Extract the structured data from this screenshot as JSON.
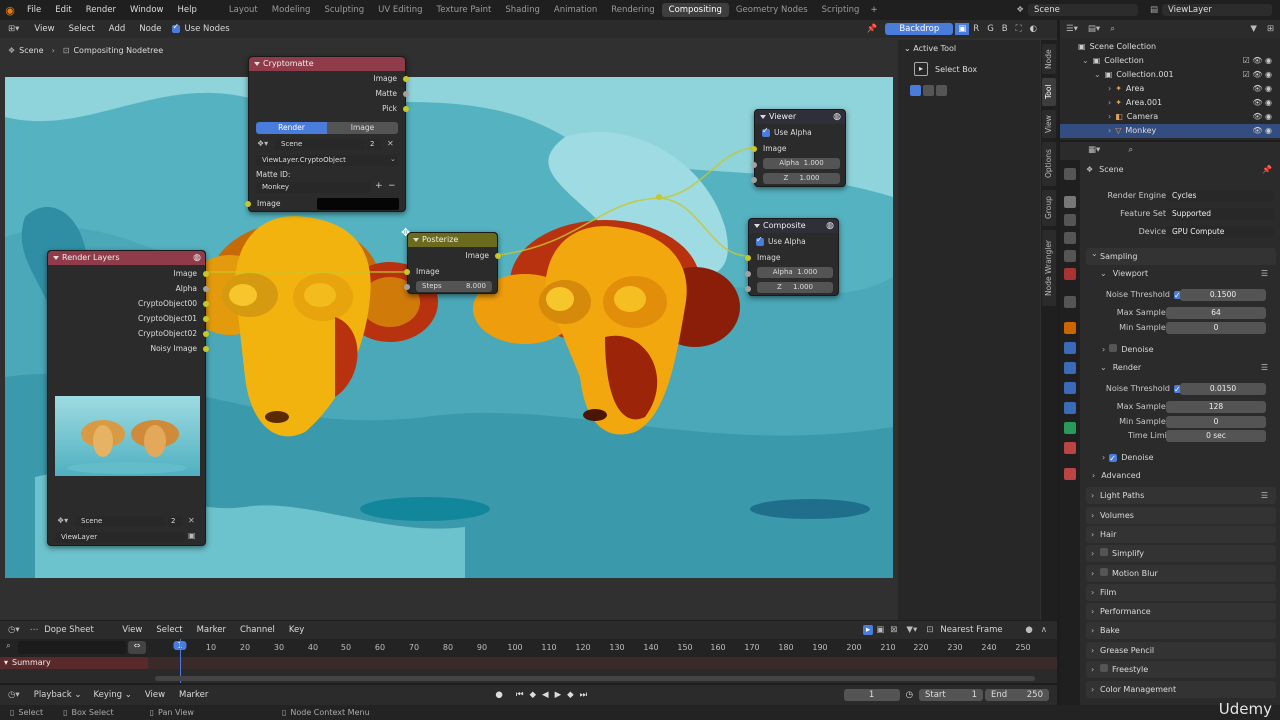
{
  "topbar": {
    "menus": [
      "File",
      "Edit",
      "Render",
      "Window",
      "Help"
    ],
    "workspaces": [
      "Layout",
      "Modeling",
      "Sculpting",
      "UV Editing",
      "Texture Paint",
      "Shading",
      "Animation",
      "Rendering",
      "Compositing",
      "Geometry Nodes",
      "Scripting"
    ],
    "active_workspace": "Compositing",
    "scene_name": "Scene",
    "view_layer": "ViewLayer"
  },
  "node_editor": {
    "menus": [
      "View",
      "Select",
      "Add",
      "Node"
    ],
    "use_nodes_label": "Use Nodes",
    "backdrop_label": "Backdrop",
    "channels": [
      "R",
      "G",
      "B"
    ],
    "breadcrumb": [
      "Scene",
      "Compositing Nodetree"
    ]
  },
  "nodes": {
    "cryptomatte": {
      "title": "Cryptomatte",
      "outputs": [
        "Image",
        "Matte",
        "Pick"
      ],
      "tabs": [
        "Render",
        "Image"
      ],
      "scene": "Scene",
      "scene_users": "2",
      "layer": "ViewLayer.CryptoObject",
      "matte_id_label": "Matte ID:",
      "matte_id": "Monkey",
      "input": "Image"
    },
    "render_layers": {
      "title": "Render Layers",
      "outputs": [
        "Image",
        "Alpha",
        "CryptoObject00",
        "CryptoObject01",
        "CryptoObject02",
        "Noisy Image"
      ],
      "scene": "Scene",
      "scene_users": "2",
      "layer": "ViewLayer"
    },
    "posterize": {
      "title": "Posterize",
      "output": "Image",
      "input": "Image",
      "steps_label": "Steps",
      "steps_value": "8.000"
    },
    "viewer": {
      "title": "Viewer",
      "use_alpha": "Use Alpha",
      "input": "Image",
      "alpha_label": "Alpha",
      "alpha_value": "1.000",
      "z_label": "Z",
      "z_value": "1.000"
    },
    "composite": {
      "title": "Composite",
      "use_alpha": "Use Alpha",
      "input": "Image",
      "alpha_label": "Alpha",
      "alpha_value": "1.000",
      "z_label": "Z",
      "z_value": "1.000"
    }
  },
  "tool_panel": {
    "title": "Active Tool",
    "tool": "Select Box",
    "vertical_tabs": [
      "Node",
      "Tool",
      "View",
      "Options",
      "Group",
      "Node Wrangler"
    ]
  },
  "outliner": {
    "rows": [
      {
        "label": "Scene Collection",
        "indent": 0
      },
      {
        "label": "Collection",
        "indent": 1
      },
      {
        "label": "Collection.001",
        "indent": 2
      },
      {
        "label": "Area",
        "indent": 3
      },
      {
        "label": "Area.001",
        "indent": 3
      },
      {
        "label": "Camera",
        "indent": 3
      },
      {
        "label": "Monkey",
        "indent": 3
      }
    ]
  },
  "properties": {
    "scene_label": "Scene",
    "render_engine_label": "Render Engine",
    "render_engine": "Cycles",
    "feature_set_label": "Feature Set",
    "feature_set": "Supported",
    "device_label": "Device",
    "device": "GPU Compute",
    "sampling": "Sampling",
    "viewport": "Viewport",
    "vp_noise_label": "Noise Threshold",
    "vp_noise": "0.1500",
    "vp_max_label": "Max Samples",
    "vp_max": "64",
    "vp_min_label": "Min Samples",
    "vp_min": "0",
    "vp_denoise": "Denoise",
    "render": "Render",
    "r_noise_label": "Noise Threshold",
    "r_noise": "0.0150",
    "r_max_label": "Max Samples",
    "r_max": "128",
    "r_min_label": "Min Samples",
    "r_min": "0",
    "r_time_label": "Time Limit",
    "r_time": "0 sec",
    "r_denoise": "Denoise",
    "advanced": "Advanced",
    "sections": [
      "Light Paths",
      "Volumes",
      "Hair",
      "Simplify",
      "Motion Blur",
      "Film",
      "Performance",
      "Bake",
      "Grease Pencil",
      "Freestyle",
      "Color Management"
    ]
  },
  "timeline": {
    "editor": "Dope Sheet",
    "menus": [
      "View",
      "Select",
      "Marker",
      "Channel",
      "Key"
    ],
    "snap": "Nearest Frame",
    "ticks": [
      "1",
      "10",
      "20",
      "30",
      "40",
      "50",
      "60",
      "70",
      "80",
      "90",
      "100",
      "110",
      "120",
      "130",
      "140",
      "150",
      "160",
      "170",
      "180",
      "190",
      "200",
      "210",
      "220",
      "230",
      "240",
      "250"
    ],
    "summary": "Summary",
    "playback": "Playback",
    "keying": "Keying",
    "view": "View",
    "marker": "Marker",
    "current_frame": "1",
    "start_label": "Start",
    "start": "1",
    "end_label": "End",
    "end": "250"
  },
  "statusbar": {
    "items": [
      "Select",
      "Box Select",
      "Pan View",
      "Node Context Menu"
    ],
    "watermark": "Udemy"
  },
  "colors": {
    "accent": "#4a7ddb",
    "node_socket_image": "#c7c729",
    "node_socket_value": "#a1a1a1",
    "header_input": "#8f3b49",
    "header_filter": "#6b6b1e",
    "header_output": "#2f2f3a"
  }
}
